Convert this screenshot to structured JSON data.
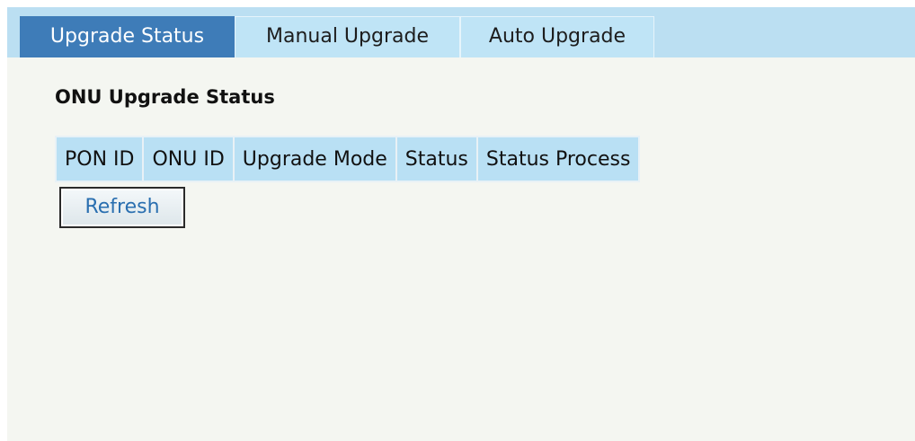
{
  "tabs": [
    {
      "label": "Upgrade Status",
      "active": true
    },
    {
      "label": "Manual Upgrade",
      "active": false
    },
    {
      "label": "Auto Upgrade",
      "active": false
    }
  ],
  "section": {
    "title": "ONU Upgrade Status"
  },
  "table": {
    "columns": [
      "PON ID",
      "ONU ID",
      "Upgrade Mode",
      "Status",
      "Status Process"
    ],
    "rows": []
  },
  "actions": {
    "refresh_label": "Refresh"
  },
  "colors": {
    "tabbar_bg": "#bbdff2",
    "active_tab_bg": "#3e7cb8",
    "inactive_tab_bg": "#bfe4f6",
    "content_bg": "#f4f6f1",
    "table_header_bg": "#b9e0f4",
    "button_text": "#2a6fb0"
  }
}
